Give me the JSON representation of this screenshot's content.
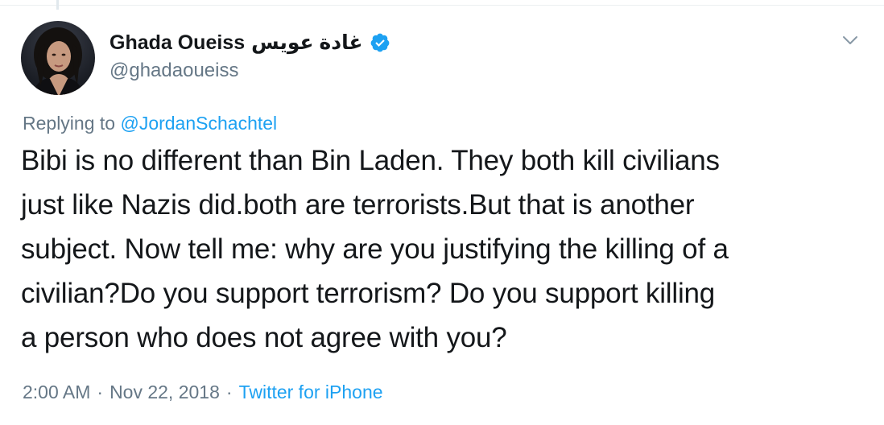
{
  "tweet": {
    "display_name": "Ghada Oueiss",
    "arabic_name": "غادة عويس",
    "handle": "@ghadaoueiss",
    "replying_prefix": "Replying to",
    "replying_to": "@JordanSchachtel",
    "text": "Bibi is no different than Bin Laden. They both kill civilians\njust like Nazis did.both are terrorists.But that is another\nsubject. Now tell me: why are you justifying the killing of a\ncivilian?Do you support terrorism? Do you support killing\na person who does not agree with you?",
    "time": "2:00 AM",
    "separator": "·",
    "date": "Nov 22, 2018",
    "source": "Twitter for iPhone"
  },
  "icons": {
    "verified": "verified-badge-icon",
    "more": "chevron-down-icon"
  },
  "colors": {
    "link": "#1da1f2",
    "secondary_text": "#657786",
    "primary_text": "#14171a"
  }
}
